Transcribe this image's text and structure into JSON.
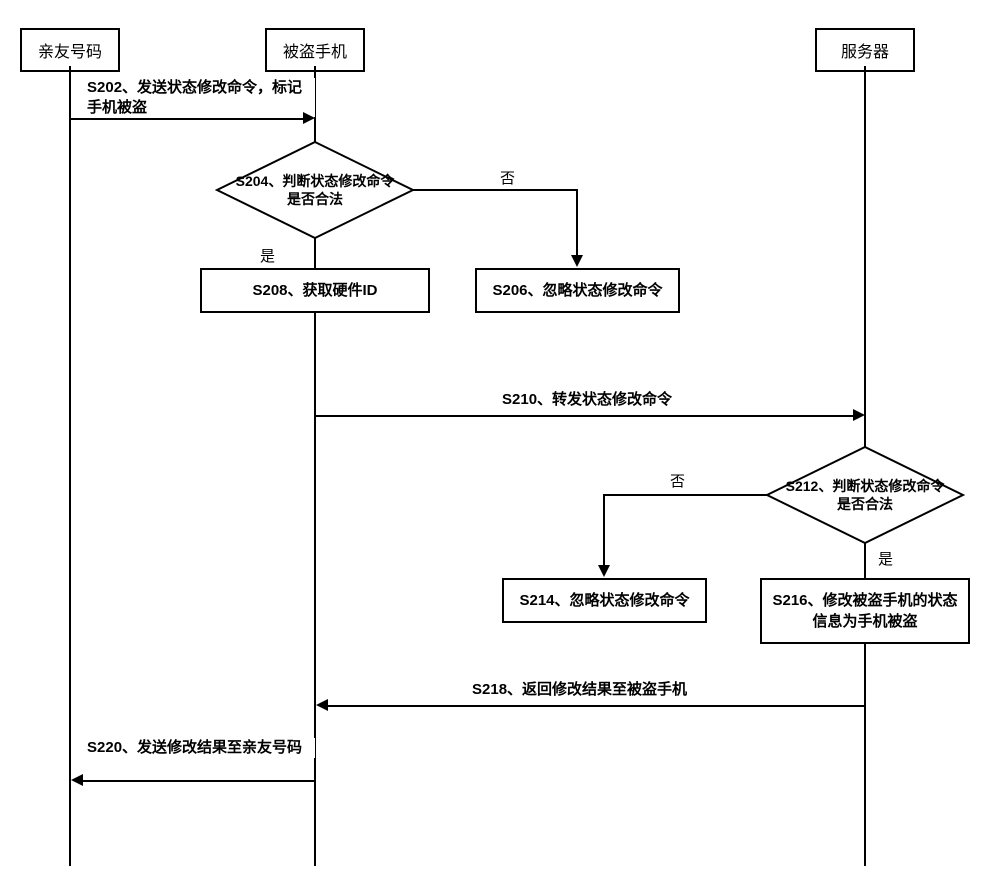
{
  "actors": {
    "friend": "亲友号码",
    "phone": "被盗手机",
    "server": "服务器"
  },
  "steps": {
    "s202": "S202、发送状态修改命令，标记手机被盗",
    "s204": "S204、判断状态修改命令是否合法",
    "s206": "S206、忽略状态修改命令",
    "s208": "S208、获取硬件ID",
    "s210": "S210、转发状态修改命令",
    "s212": "S212、判断状态修改命令是否合法",
    "s214": "S214、忽略状态修改命令",
    "s216": "S216、修改被盗手机的状态信息为手机被盗",
    "s218": "S218、返回修改结果至被盗手机",
    "s220": "S220、发送修改结果至亲友号码"
  },
  "branches": {
    "yes": "是",
    "no": "否"
  },
  "chart_data": {
    "type": "sequence-flowchart",
    "title": "",
    "actors": [
      "亲友号码",
      "被盗手机",
      "服务器"
    ],
    "nodes": [
      {
        "id": "S202",
        "type": "message",
        "from": "亲友号码",
        "to": "被盗手机",
        "text": "发送状态修改命令，标记手机被盗"
      },
      {
        "id": "S204",
        "type": "decision",
        "lane": "被盗手机",
        "text": "判断状态修改命令是否合法"
      },
      {
        "id": "S206",
        "type": "process",
        "lane": "被盗手机",
        "text": "忽略状态修改命令",
        "from_decision": "S204",
        "branch": "否"
      },
      {
        "id": "S208",
        "type": "process",
        "lane": "被盗手机",
        "text": "获取硬件ID",
        "from_decision": "S204",
        "branch": "是"
      },
      {
        "id": "S210",
        "type": "message",
        "from": "被盗手机",
        "to": "服务器",
        "text": "转发状态修改命令"
      },
      {
        "id": "S212",
        "type": "decision",
        "lane": "服务器",
        "text": "判断状态修改命令是否合法"
      },
      {
        "id": "S214",
        "type": "process",
        "lane": "服务器",
        "text": "忽略状态修改命令",
        "from_decision": "S212",
        "branch": "否"
      },
      {
        "id": "S216",
        "type": "process",
        "lane": "服务器",
        "text": "修改被盗手机的状态信息为手机被盗",
        "from_decision": "S212",
        "branch": "是"
      },
      {
        "id": "S218",
        "type": "message",
        "from": "服务器",
        "to": "被盗手机",
        "text": "返回修改结果至被盗手机"
      },
      {
        "id": "S220",
        "type": "message",
        "from": "被盗手机",
        "to": "亲友号码",
        "text": "发送修改结果至亲友号码"
      }
    ]
  }
}
